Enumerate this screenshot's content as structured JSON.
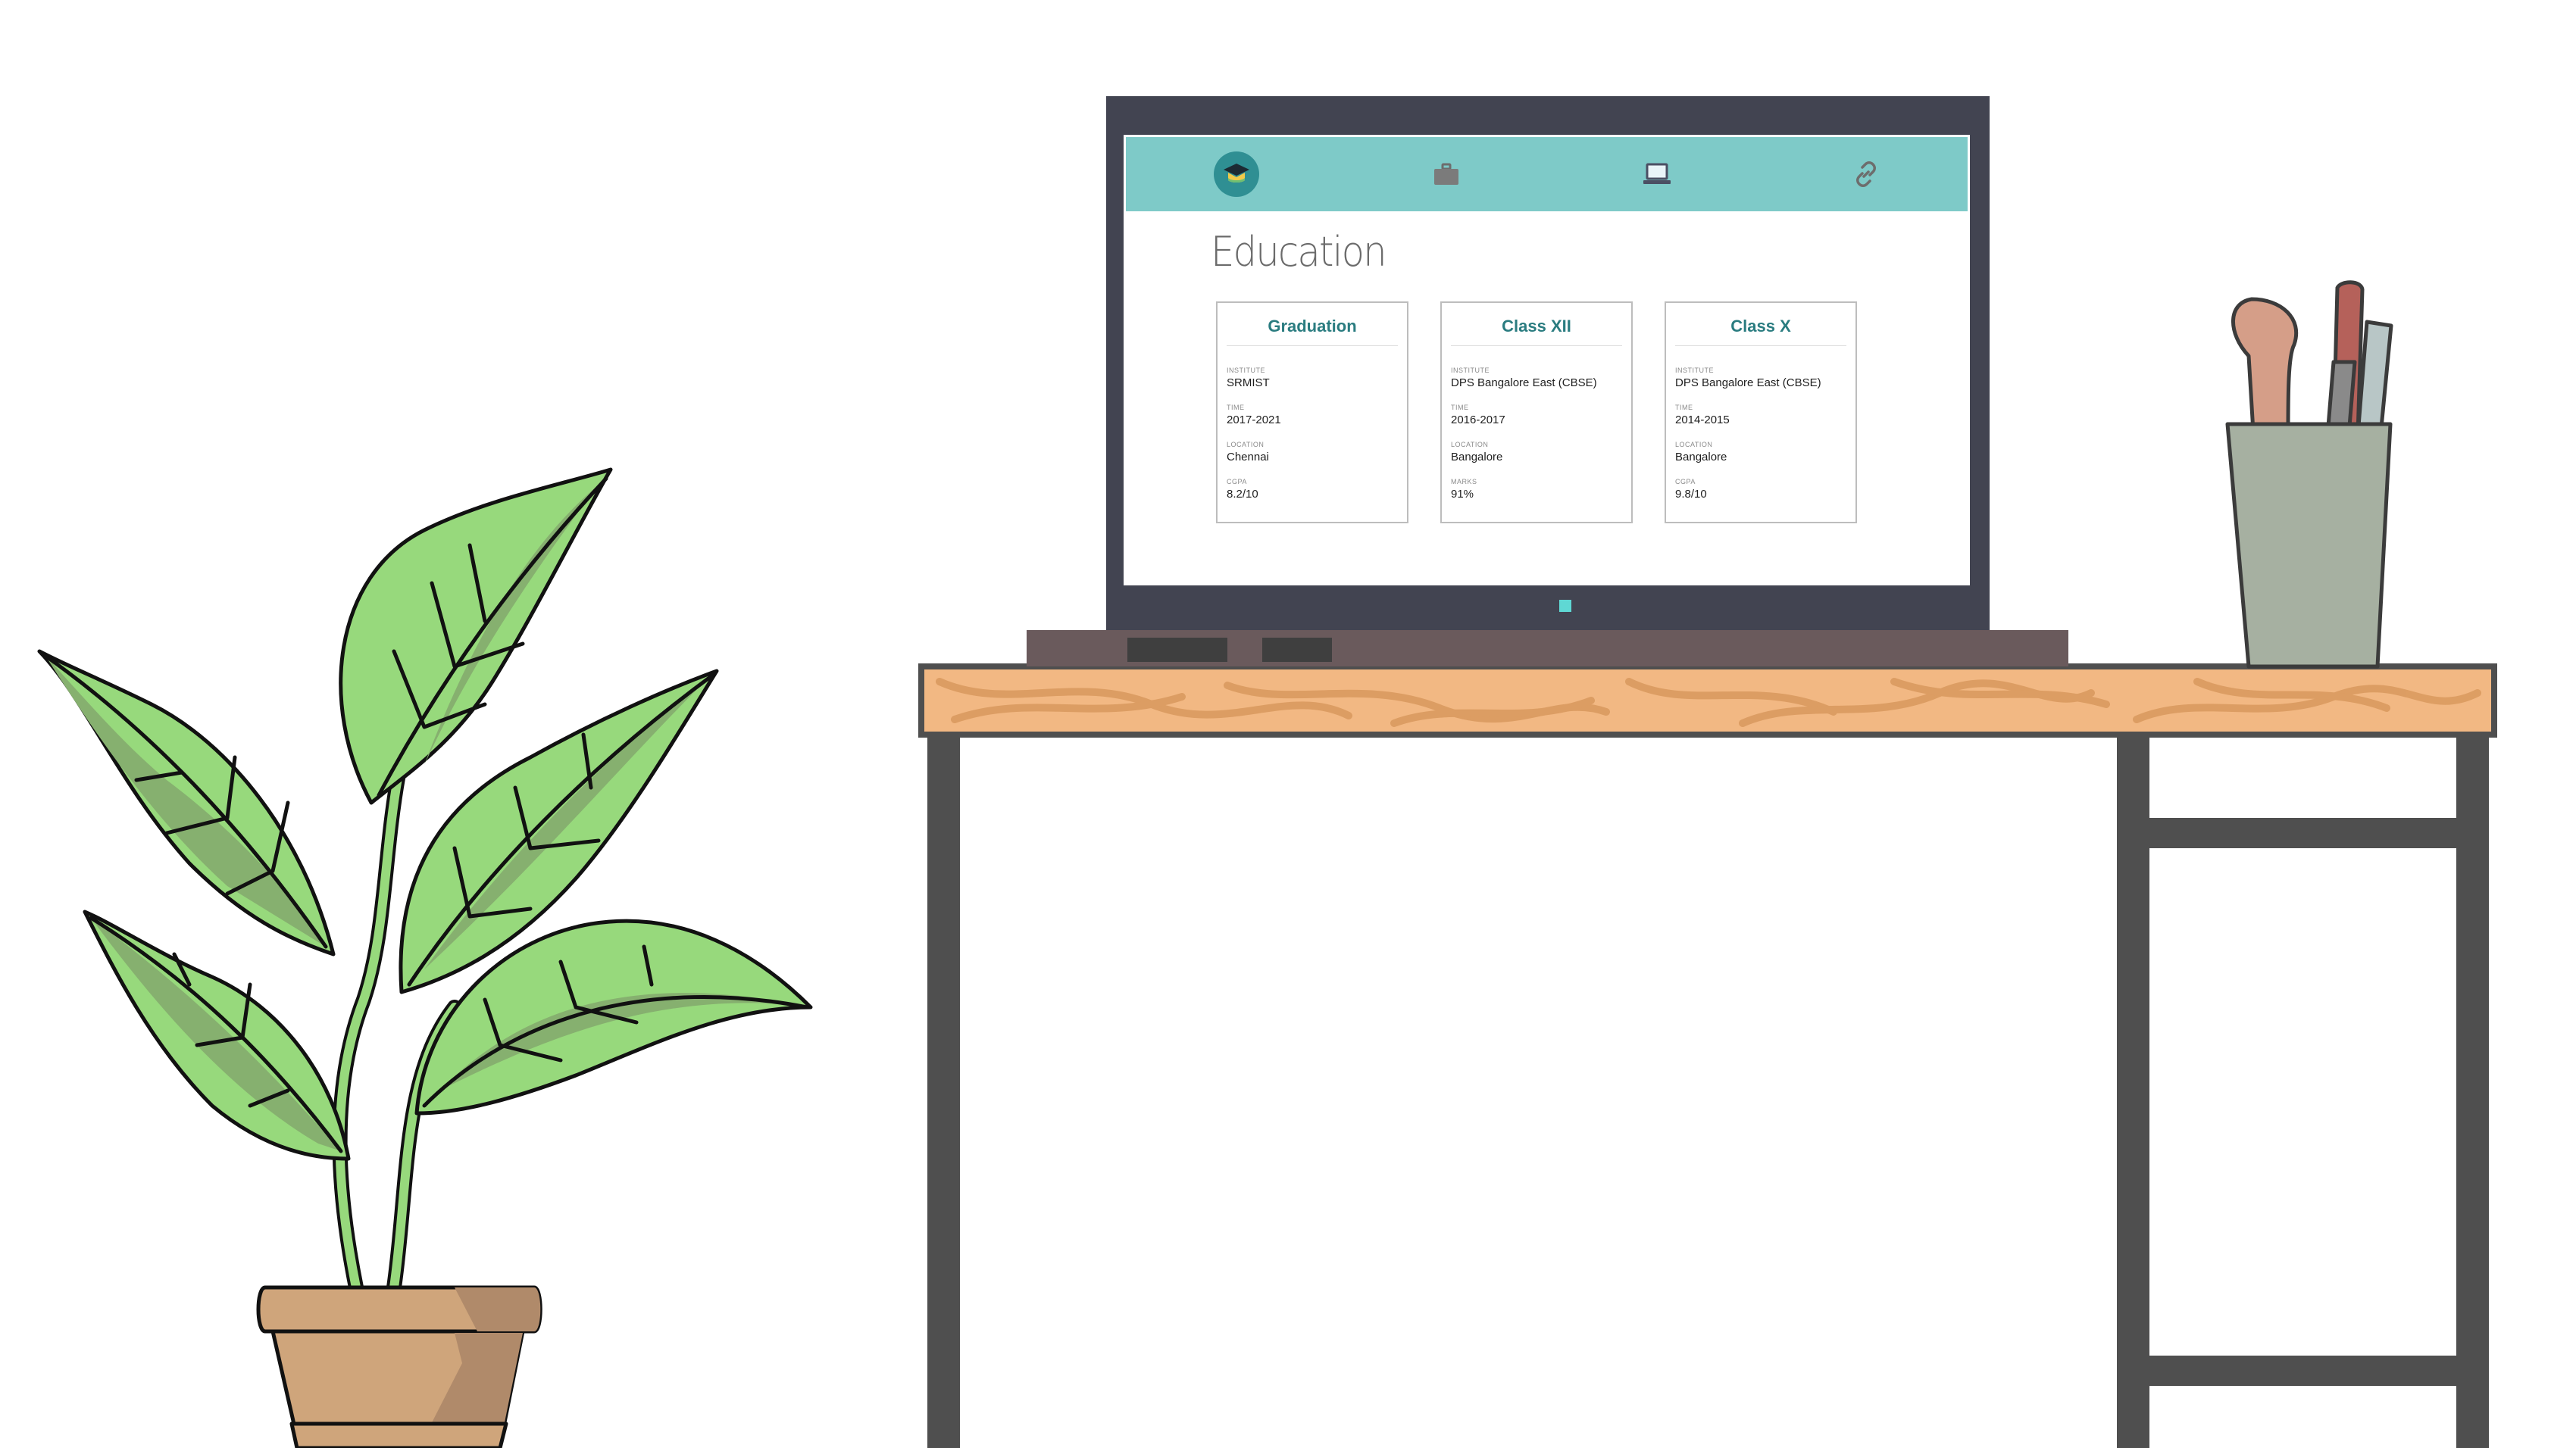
{
  "nav": {
    "items": [
      {
        "icon": "graduation-cap-icon",
        "active": true
      },
      {
        "icon": "briefcase-icon",
        "active": false
      },
      {
        "icon": "laptop-icon",
        "active": false
      },
      {
        "icon": "link-icon",
        "active": false
      }
    ]
  },
  "section_title": "Education",
  "cards": [
    {
      "title": "Graduation",
      "fields": [
        {
          "label": "INSTITUTE",
          "value": "SRMIST"
        },
        {
          "label": "TIME",
          "value": "2017-2021"
        },
        {
          "label": "LOCATION",
          "value": "Chennai"
        },
        {
          "label": "CGPA",
          "value": "8.2/10"
        }
      ]
    },
    {
      "title": "Class XII",
      "fields": [
        {
          "label": "INSTITUTE",
          "value": "DPS Bangalore East (CBSE)"
        },
        {
          "label": "TIME",
          "value": "2016-2017"
        },
        {
          "label": "LOCATION",
          "value": "Bangalore"
        },
        {
          "label": "MARKS",
          "value": "91%"
        }
      ]
    },
    {
      "title": "Class X",
      "fields": [
        {
          "label": "INSTITUTE",
          "value": "DPS Bangalore East (CBSE)"
        },
        {
          "label": "TIME",
          "value": "2014-2015"
        },
        {
          "label": "LOCATION",
          "value": "Bangalore"
        },
        {
          "label": "CGPA",
          "value": "9.8/10"
        }
      ]
    }
  ],
  "colors": {
    "nav_bar": "#7ecac8",
    "accent": "#2a7c80",
    "laptop_bezel": "#424451",
    "desk_wood": "#f2b883",
    "desk_frame": "#4f4f4f",
    "leaf_light": "#97d97c",
    "leaf_dark": "#86b06f",
    "pot": "#cfa57b",
    "cup": "#a6b0a1"
  }
}
